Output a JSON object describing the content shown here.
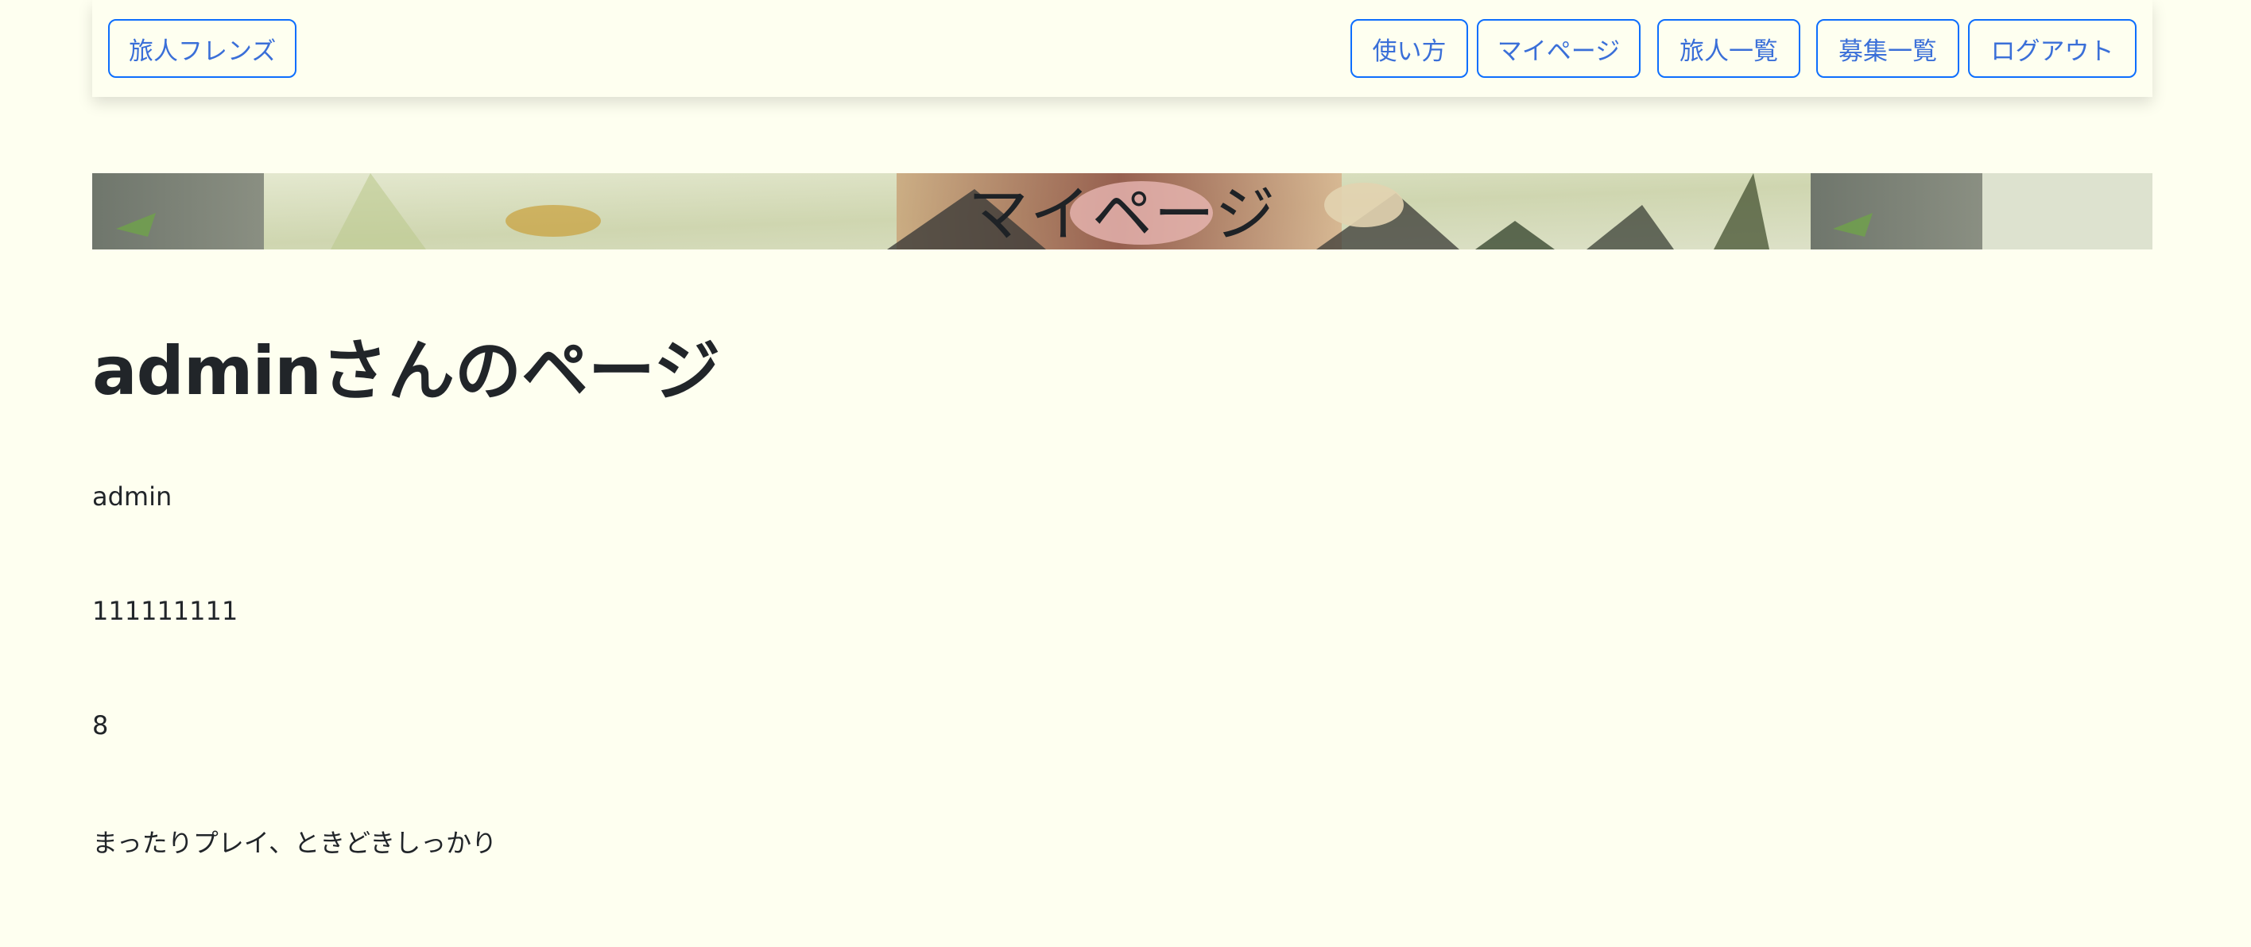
{
  "navbar": {
    "brand_label": "旅人フレンズ",
    "links": {
      "how_to": "使い方",
      "mypage": "マイページ",
      "travelers": "旅人一覧",
      "recruitments": "募集一覧",
      "logout": "ログアウト"
    },
    "accent_color": "#0d6efd"
  },
  "hero": {
    "title": "マイページ"
  },
  "profile": {
    "heading_name": "admin",
    "heading_suffix": "さんのページ",
    "username": "admin",
    "id_number": "111111111",
    "count": "8",
    "play_style": "まったりプレイ、ときどきしっかり"
  }
}
